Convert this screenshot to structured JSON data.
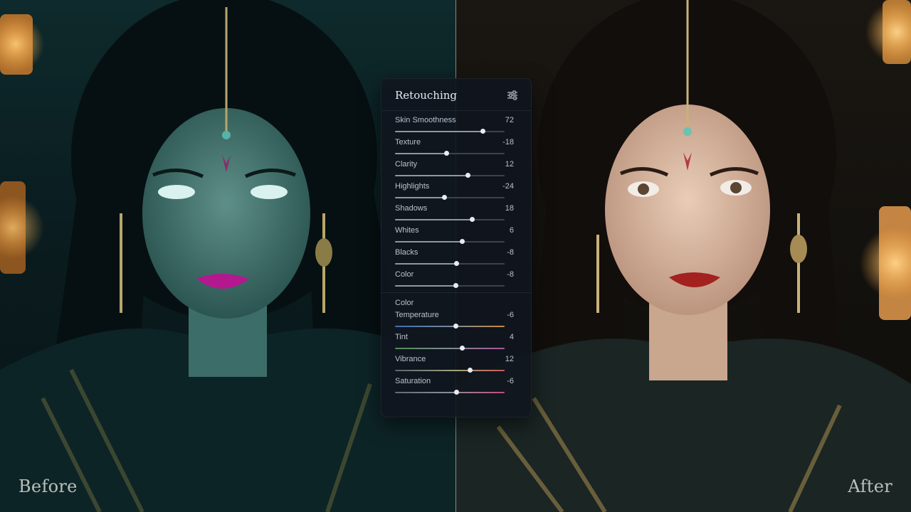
{
  "labels": {
    "before": "Before",
    "after": "After"
  },
  "panel": {
    "title": "Retouching",
    "settings_icon": "sliders-settings-icon",
    "tone_sliders": [
      {
        "label": "Skin Smoothness",
        "value": "72",
        "pos": 0.8
      },
      {
        "label": "Texture",
        "value": "-18",
        "pos": 0.47
      },
      {
        "label": "Clarity",
        "value": "12",
        "pos": 0.66
      },
      {
        "label": "Highlights",
        "value": "-24",
        "pos": 0.45
      },
      {
        "label": "Shadows",
        "value": "18",
        "pos": 0.7
      },
      {
        "label": "Whites",
        "value": "6",
        "pos": 0.61
      },
      {
        "label": "Blacks",
        "value": "-8",
        "pos": 0.56
      },
      {
        "label": "Color",
        "value": "-8",
        "pos": 0.55
      }
    ],
    "color_section_title": "Color",
    "color_sliders": [
      {
        "label": "Temperature",
        "value": "-6",
        "pos": 0.55,
        "style": "temp"
      },
      {
        "label": "Tint",
        "value": "4",
        "pos": 0.61,
        "style": "tint"
      },
      {
        "label": "Vibrance",
        "value": "12",
        "pos": 0.68,
        "style": "vib"
      },
      {
        "label": "Saturation",
        "value": "-6",
        "pos": 0.56,
        "style": "sat"
      }
    ]
  },
  "colors": {
    "panel_bg": "#10161e",
    "slider_thumb": "#e8ecef",
    "before_tint": "#0e2a2c",
    "after_tint": "#1a1712"
  }
}
